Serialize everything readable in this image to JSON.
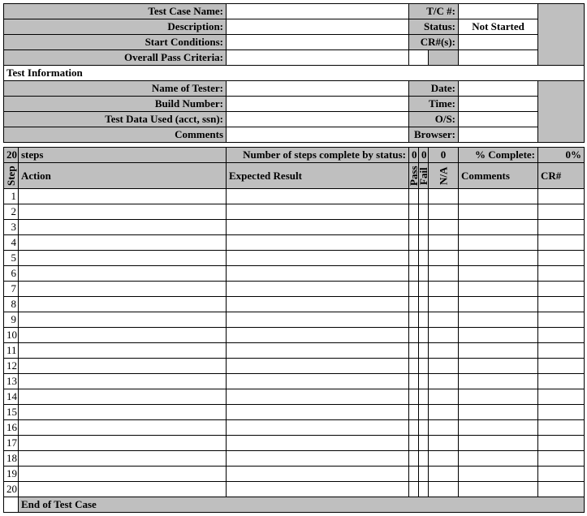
{
  "header1": {
    "testCaseNameLabel": "Test Case Name:",
    "descriptionLabel": "Description:",
    "startConditionsLabel": "Start Conditions:",
    "overallPassLabel": "Overall Pass Criteria:",
    "tcNumLabel": "T/C #:",
    "statusLabel": "Status:",
    "crNumsLabel": "CR#(s):",
    "statusValue": "Not Started",
    "testCaseName": "",
    "description": "",
    "startConditions": "",
    "overallPass": "",
    "tcNum": "",
    "crNums": ""
  },
  "testInfoTitle": "Test Information",
  "header2": {
    "nameOfTesterLabel": "Name of Tester:",
    "buildNumberLabel": "Build Number:",
    "testDataUsedLabel": "Test Data Used (acct, ssn):",
    "commentsLabel": "Comments",
    "dateLabel": "Date:",
    "timeLabel": "Time:",
    "osLabel": "O/S:",
    "browserLabel": "Browser:",
    "nameOfTester": "",
    "buildNumber": "",
    "testDataUsed": "",
    "comments": "",
    "date": "",
    "time": "",
    "os": "",
    "browser": ""
  },
  "stepsBar": {
    "stepCount": "20",
    "stepsWord": "steps",
    "numCompleteLabel": "Number of steps complete by status:",
    "pass": "0",
    "fail": "0",
    "na": "0",
    "pctCompleteLabel": "% Complete:",
    "pctCompleteValue": "0%"
  },
  "cols": {
    "step": "Step",
    "action": "Action",
    "expected": "Expected Result",
    "pass": "Pass",
    "fail": "Fail",
    "na": "N/A",
    "comments": "Comments",
    "cr": "CR#"
  },
  "rows": [
    "1",
    "2",
    "3",
    "4",
    "5",
    "6",
    "7",
    "8",
    "9",
    "10",
    "11",
    "12",
    "13",
    "14",
    "15",
    "16",
    "17",
    "18",
    "19",
    "20"
  ],
  "endOfTestCase": "End of Test Case"
}
